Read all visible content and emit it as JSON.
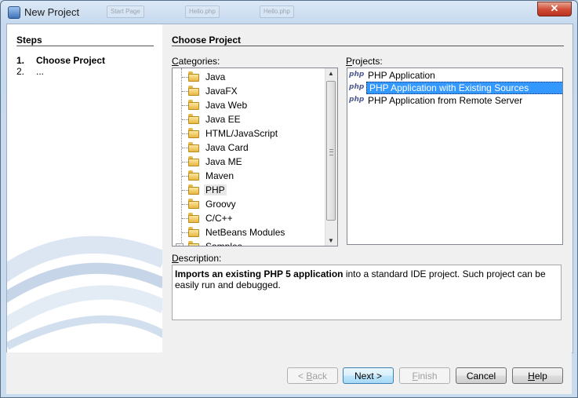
{
  "window": {
    "title": "New Project",
    "close_label": "✕",
    "background_tabs": [
      "Start Page",
      "Hello.php",
      "Hello.php"
    ]
  },
  "steps": {
    "heading": "Steps",
    "items": [
      {
        "num": "1.",
        "label": "Choose Project"
      },
      {
        "num": "2.",
        "label": "..."
      }
    ]
  },
  "main": {
    "heading": "Choose Project",
    "categories_label": "Categories:",
    "projects_label": "Projects:",
    "categories": [
      {
        "label": "Java"
      },
      {
        "label": "JavaFX"
      },
      {
        "label": "Java Web"
      },
      {
        "label": "Java EE"
      },
      {
        "label": "HTML/JavaScript"
      },
      {
        "label": "Java Card"
      },
      {
        "label": "Java ME"
      },
      {
        "label": "Maven"
      },
      {
        "label": "PHP",
        "selected": true
      },
      {
        "label": "Groovy"
      },
      {
        "label": "C/C++"
      },
      {
        "label": "NetBeans Modules"
      },
      {
        "label": "Samples"
      }
    ],
    "projects": [
      {
        "icon": "php",
        "label": "PHP Application"
      },
      {
        "icon": "php",
        "label": "PHP Application with Existing Sources",
        "selected": true
      },
      {
        "icon": "php",
        "label": "PHP Application from Remote Server"
      }
    ],
    "description_label": "Description:",
    "description_bold": "Imports an existing PHP 5 application",
    "description_rest": " into a standard IDE project. Such project can be easily run and debugged."
  },
  "buttons": {
    "back": "< Back",
    "next": "Next >",
    "finish": "Finish",
    "cancel": "Cancel",
    "help": "Help"
  },
  "colors": {
    "selection": "#3399ff",
    "title_bar": "#c6d9ee",
    "close": "#cf4b35"
  }
}
